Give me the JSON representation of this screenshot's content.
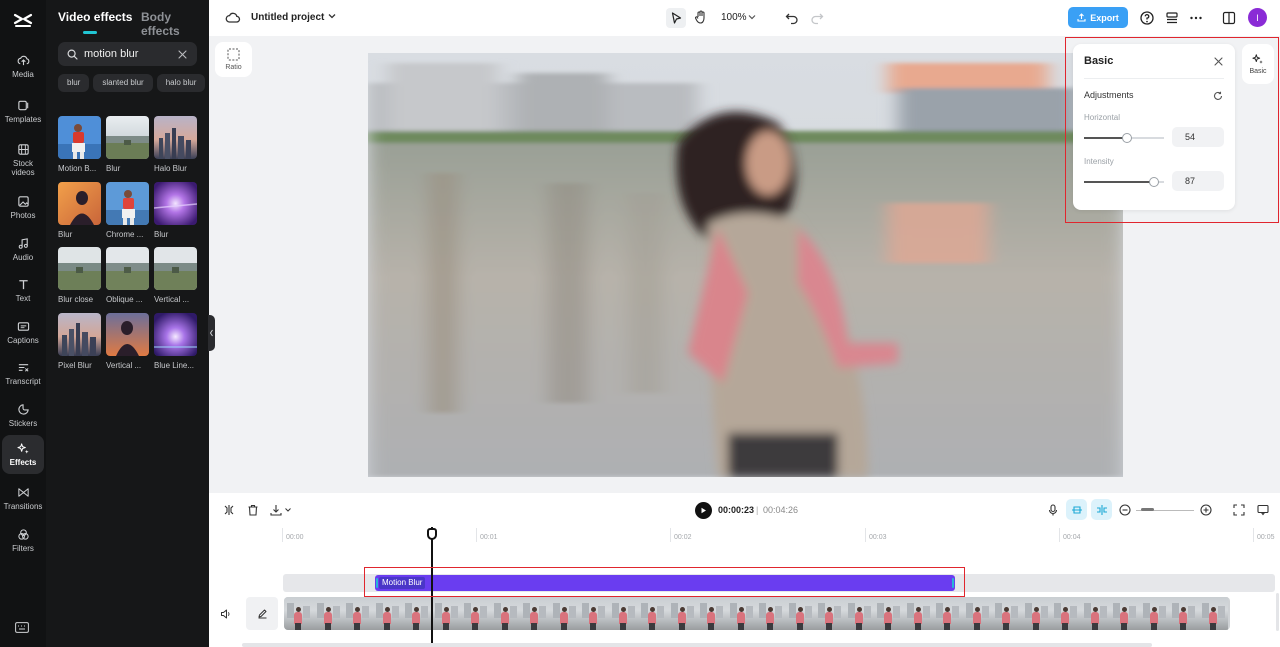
{
  "rail": {
    "items": [
      {
        "label": "Media",
        "icon": "cloud-upload-icon"
      },
      {
        "label": "Templates",
        "icon": "templates-icon"
      },
      {
        "label": "Stock videos",
        "icon": "film-icon"
      },
      {
        "label": "Photos",
        "icon": "image-icon"
      },
      {
        "label": "Audio",
        "icon": "music-note-icon"
      },
      {
        "label": "Text",
        "icon": "text-icon"
      },
      {
        "label": "Captions",
        "icon": "captions-icon"
      },
      {
        "label": "Transcript",
        "icon": "transcript-icon"
      },
      {
        "label": "Stickers",
        "icon": "sticker-icon"
      },
      {
        "label": "Effects",
        "icon": "sparkle-icon",
        "active": true
      },
      {
        "label": "Transitions",
        "icon": "transitions-icon"
      },
      {
        "label": "Filters",
        "icon": "filters-icon"
      }
    ]
  },
  "effects_panel": {
    "tabs": [
      "Video effects",
      "Body effects"
    ],
    "active_tab": "Video effects",
    "search": {
      "value": "motion blur"
    },
    "chips": [
      "blur",
      "slanted blur",
      "halo blur"
    ],
    "items": [
      {
        "label": "Motion B...",
        "thumb": "runner"
      },
      {
        "label": "Blur",
        "thumb": "field"
      },
      {
        "label": "Halo Blur",
        "thumb": "city"
      },
      {
        "label": "Blur",
        "thumb": "sunset-portrait"
      },
      {
        "label": "Chrome ...",
        "thumb": "runner"
      },
      {
        "label": "Blur",
        "thumb": "purple-glow"
      },
      {
        "label": "Blur close",
        "thumb": "field"
      },
      {
        "label": "Oblique ...",
        "thumb": "field"
      },
      {
        "label": "Vertical ...",
        "thumb": "field"
      },
      {
        "label": "Pixel Blur",
        "thumb": "city"
      },
      {
        "label": "Vertical ...",
        "thumb": "sunset-portrait"
      },
      {
        "label": "Blue Line...",
        "thumb": "purple-glow"
      }
    ]
  },
  "topbar": {
    "project_title": "Untitled project",
    "zoom": "100%",
    "export_label": "Export",
    "avatar_initial": "I"
  },
  "canvas": {
    "ratio_label": "Ratio"
  },
  "basic_panel": {
    "tab_label": "Basic",
    "title": "Basic",
    "section": "Adjustments",
    "sliders": [
      {
        "label": "Horizontal",
        "value": 54
      },
      {
        "label": "Intensity",
        "value": 87
      }
    ]
  },
  "timeline": {
    "current_time": "00:00:23",
    "separator": "|",
    "total_time": "00:04:26",
    "ruler_ticks": [
      "00:00",
      "00:01",
      "00:02",
      "00:03",
      "00:04",
      "00:05"
    ],
    "effect_clip_label": "Motion Blur",
    "colors": {
      "effect_clip": "#6a3df0",
      "accent": "#21c5d3",
      "export": "#3aa0f5"
    }
  }
}
